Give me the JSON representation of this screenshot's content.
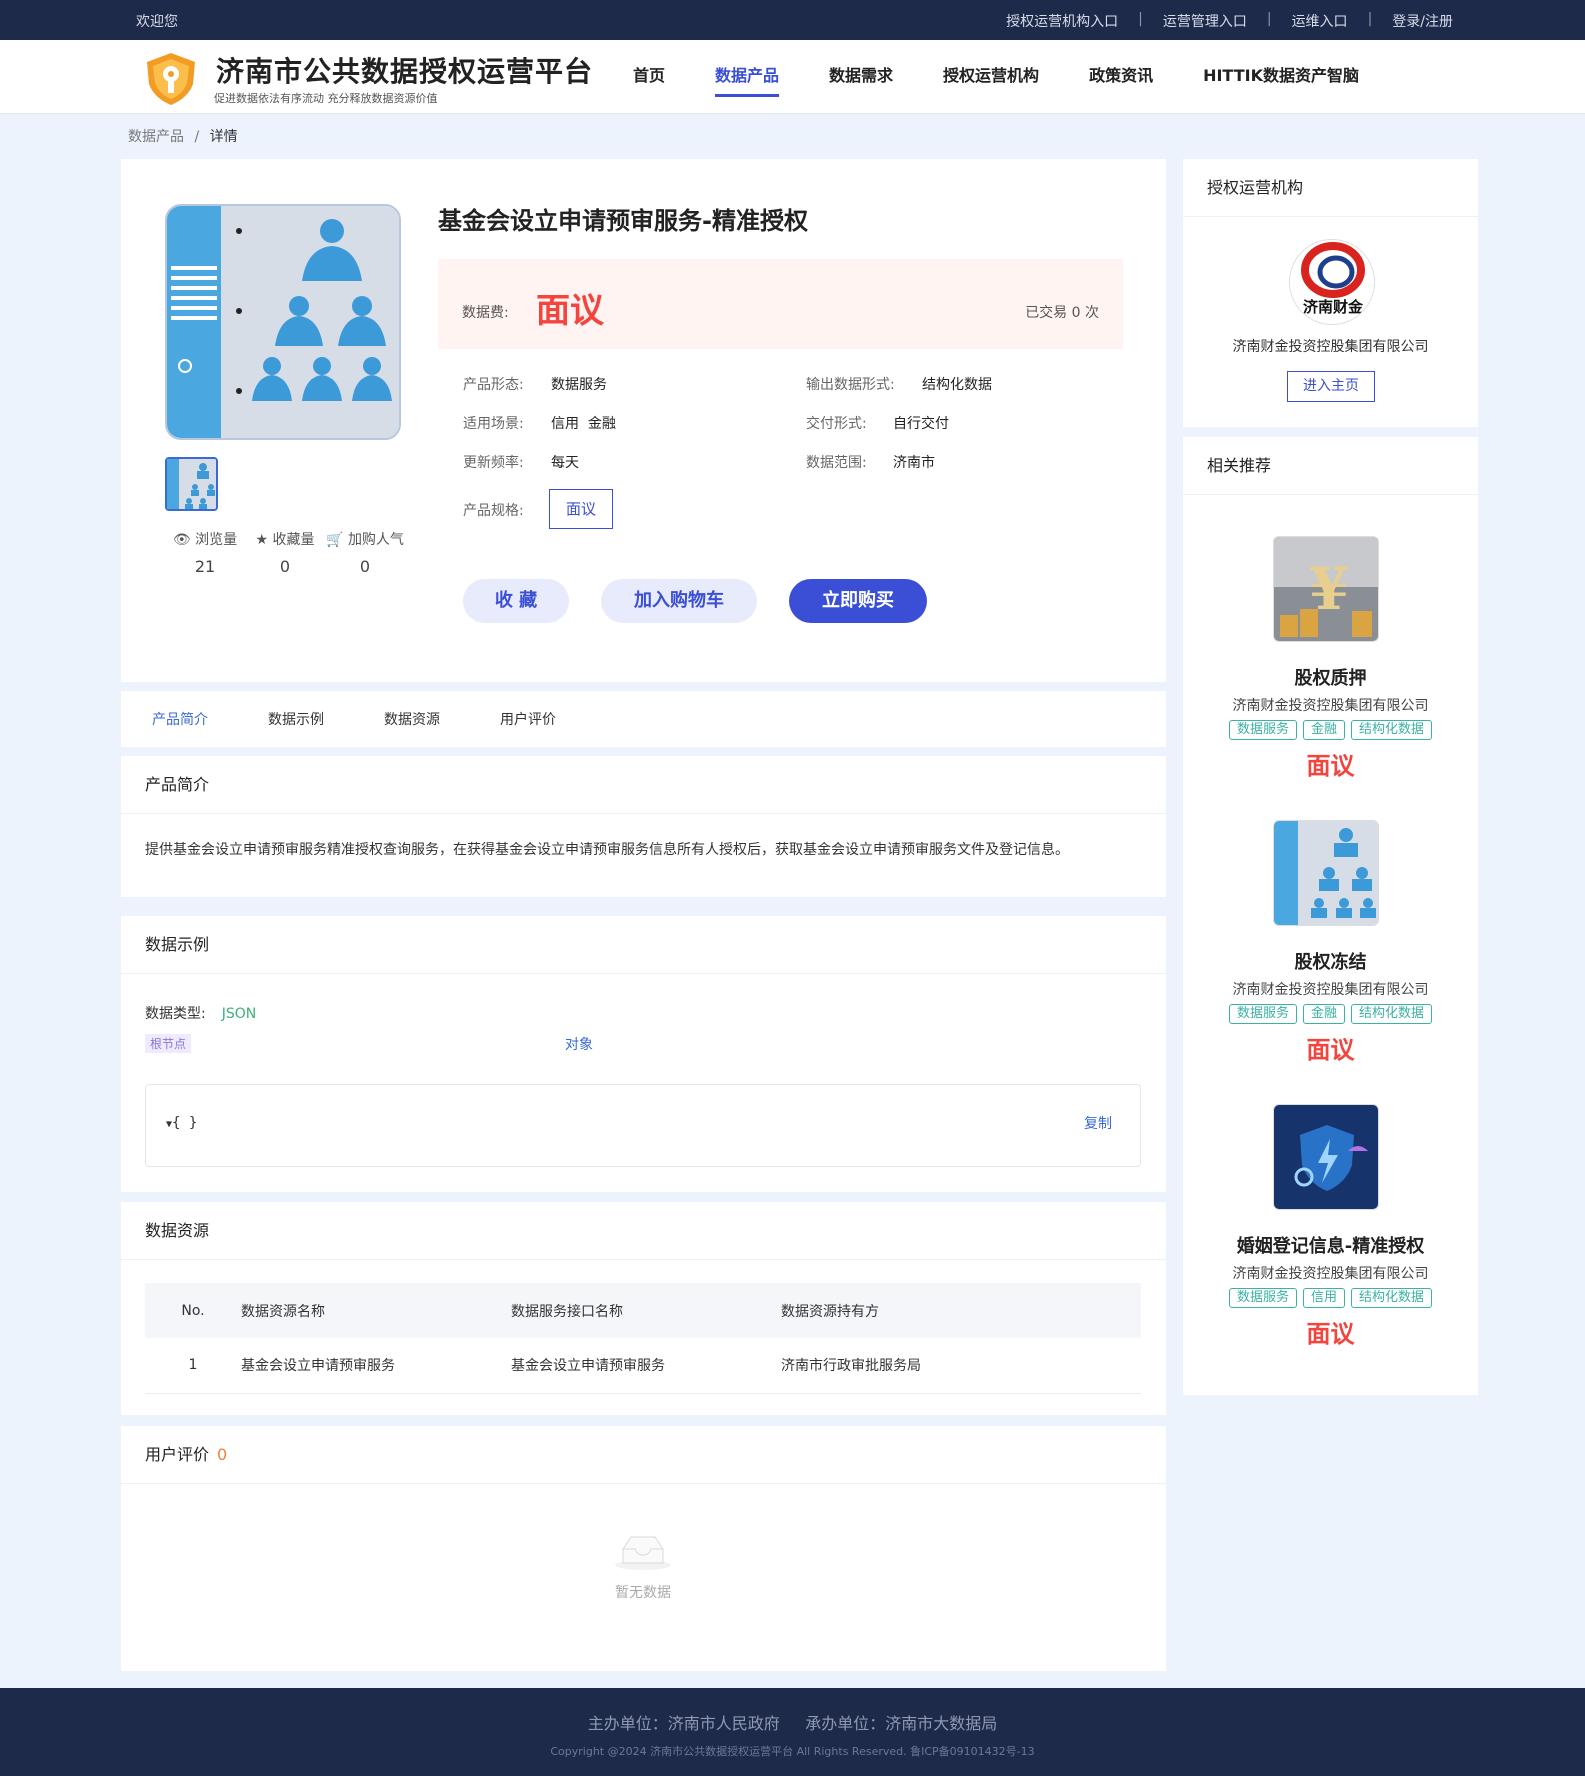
{
  "topbar": {
    "welcome": "欢迎您",
    "links": [
      "授权运营机构入口",
      "运营管理入口",
      "运维入口",
      "登录/注册"
    ]
  },
  "brand": {
    "title": "济南市公共数据授权运营平台",
    "subtitle": "促进数据依法有序流动 充分释放数据资源价值"
  },
  "nav": [
    "首页",
    "数据产品",
    "数据需求",
    "授权运营机构",
    "政策资讯",
    "HITTIK数据资产智脑"
  ],
  "nav_active": "数据产品",
  "breadcrumb": {
    "parent": "数据产品",
    "sep": "/",
    "current": "详情"
  },
  "product": {
    "title": "基金会设立申请预审服务-精准授权",
    "price_label": "数据费:",
    "price": "面议",
    "traded": "已交易 0 次",
    "attrs": [
      {
        "k": "产品形态:",
        "v": "数据服务"
      },
      {
        "k": "输出数据形式:",
        "v": "结构化数据"
      },
      {
        "k": "适用场景:",
        "v": "信用  金融"
      },
      {
        "k": "交付形式:",
        "v": "自行交付"
      },
      {
        "k": "更新频率:",
        "v": "每天"
      },
      {
        "k": "数据范围:",
        "v": "济南市"
      }
    ],
    "spec_label": "产品规格:",
    "spec": "面议",
    "stats": [
      {
        "label": "浏览量",
        "value": "21",
        "icon": "eye-icon"
      },
      {
        "label": "收藏量",
        "value": "0",
        "icon": "star-icon"
      },
      {
        "label": "加购人气",
        "value": "0",
        "icon": "cart-icon"
      }
    ],
    "buttons": {
      "fav": "收 藏",
      "cart": "加入购物车",
      "buy": "立即购买"
    }
  },
  "tabs": [
    "产品简介",
    "数据示例",
    "数据资源",
    "用户评价"
  ],
  "intro": {
    "title": "产品简介",
    "text": "提供基金会设立申请预审服务精准授权查询服务，在获得基金会设立申请预审服务信息所有人授权后，获取基金会设立申请预审服务文件及登记信息。"
  },
  "example": {
    "title": "数据示例",
    "type_label": "数据类型:",
    "type": "JSON",
    "root_tag": "根节点",
    "obj_label": "对象",
    "json_text": "{ }",
    "copy": "复制"
  },
  "resources": {
    "title": "数据资源",
    "headers": [
      "No.",
      "数据资源名称",
      "数据服务接口名称",
      "数据资源持有方"
    ],
    "rows": [
      [
        "1",
        "基金会设立申请预审服务",
        "基金会设立申请预审服务",
        "济南市行政审批服务局"
      ]
    ]
  },
  "reviews": {
    "title": "用户评价",
    "count": "0",
    "empty": "暂无数据"
  },
  "org": {
    "title": "授权运营机构",
    "name": "济南财金投资控股集团有限公司",
    "button": "进入主页",
    "logo_text": "济南财金"
  },
  "recommend": {
    "title": "相关推荐",
    "items": [
      {
        "title": "股权质押",
        "org": "济南财金投资控股集团有限公司",
        "tags": [
          "数据服务",
          "金融",
          "结构化数据"
        ],
        "price": "面议"
      },
      {
        "title": "股权冻结",
        "org": "济南财金投资控股集团有限公司",
        "tags": [
          "数据服务",
          "金融",
          "结构化数据"
        ],
        "price": "面议"
      },
      {
        "title": "婚姻登记信息-精准授权",
        "org": "济南财金投资控股集团有限公司",
        "tags": [
          "数据服务",
          "信用",
          "结构化数据"
        ],
        "price": "面议"
      }
    ]
  },
  "footer": {
    "line1": "主办单位：济南市人民政府     承办单位：济南市大数据局",
    "line2": "Copyright @2024 济南市公共数据授权运营平台 All Rights Reserved. 鲁ICP备09101432号-13"
  },
  "colors": {
    "accent": "#3a4fd6",
    "price": "#f4443e",
    "tag": "#3bb2a2",
    "topbar": "#1e2a4a"
  }
}
